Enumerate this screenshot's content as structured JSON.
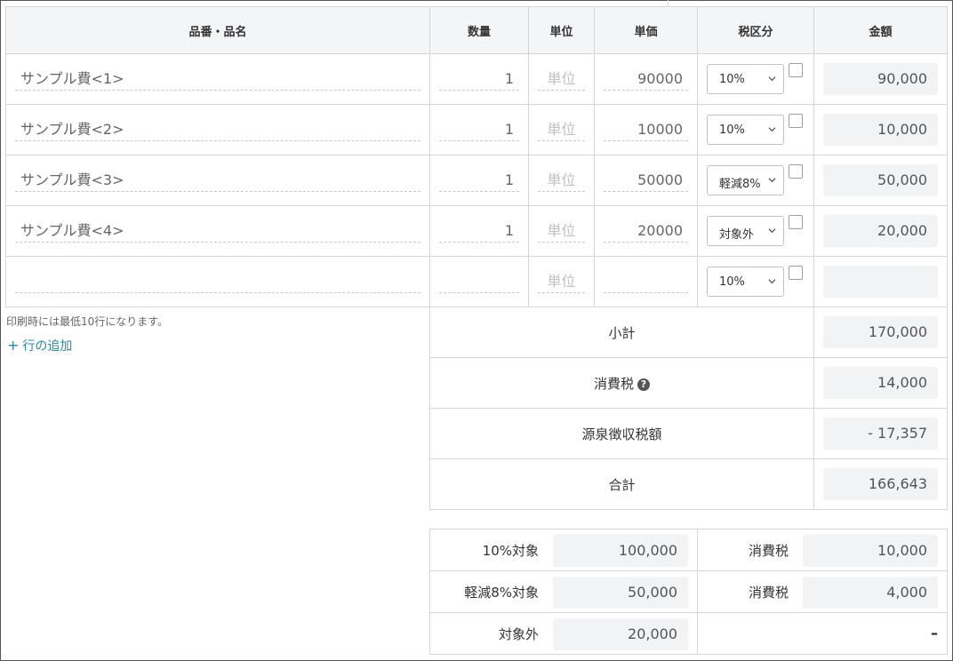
{
  "columns": {
    "name": "品番・品名",
    "qty": "数量",
    "unit": "単位",
    "price": "単価",
    "tax": "税区分",
    "amount": "金額"
  },
  "rows": [
    {
      "name": "サンプル費<1>",
      "qty": "1",
      "unit": "単位",
      "price": "90000",
      "tax": "10%",
      "amount": "90,000"
    },
    {
      "name": "サンプル費<2>",
      "qty": "1",
      "unit": "単位",
      "price": "10000",
      "tax": "10%",
      "amount": "10,000"
    },
    {
      "name": "サンプル費<3>",
      "qty": "1",
      "unit": "単位",
      "price": "50000",
      "tax": "軽減8%",
      "amount": "50,000"
    },
    {
      "name": "サンプル費<4>",
      "qty": "1",
      "unit": "単位",
      "price": "20000",
      "tax": "対象外",
      "amount": "20,000"
    },
    {
      "name": "",
      "qty": "",
      "unit": "単位",
      "price": "",
      "tax": "10%",
      "amount": ""
    }
  ],
  "note": "印刷時には最低10行になります。",
  "add_row": {
    "plus": "+",
    "label": "行の追加"
  },
  "summary": {
    "subtotal_label": "小計",
    "subtotal": "170,000",
    "tax_label": "消費税",
    "help": "?",
    "tax": "14,000",
    "withholding_label": "源泉徴収税額",
    "withholding": "- 17,357",
    "total_label": "合計",
    "total": "166,643"
  },
  "breakdown": {
    "r10_label": "10%対象",
    "r10_value": "100,000",
    "r10_tax_label": "消費税",
    "r10_tax": "10,000",
    "r8_label": "軽減8%対象",
    "r8_value": "50,000",
    "r8_tax_label": "消費税",
    "r8_tax": "4,000",
    "ex_label": "対象外",
    "ex_value": "20,000",
    "ex_dash": "–"
  },
  "colors": {
    "accent": "#2a8a9a",
    "header_bg": "#f4f5f7",
    "box_bg": "#f2f3f5",
    "border": "#d6d6d6"
  }
}
